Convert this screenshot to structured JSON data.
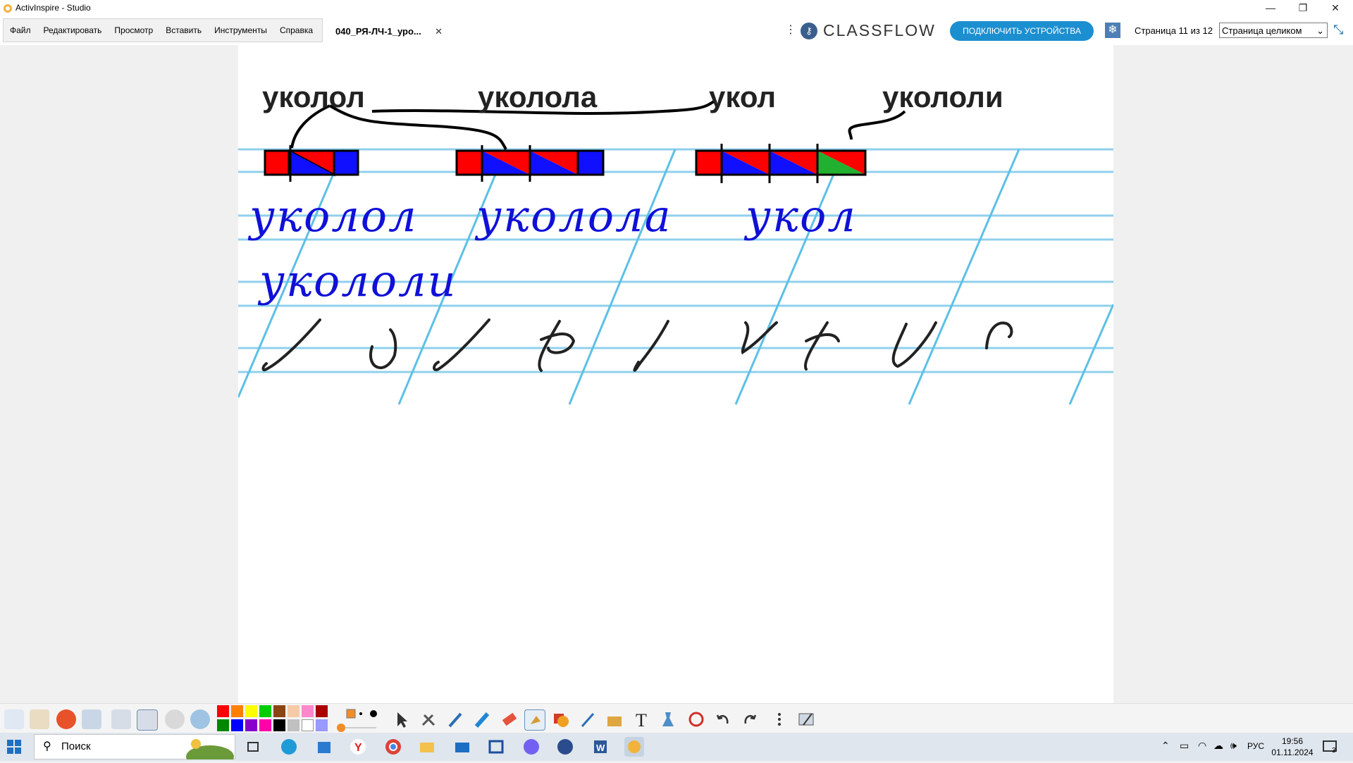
{
  "window": {
    "title": "ActivInspire - Studio",
    "minimize": "—",
    "restore": "❐",
    "close": "✕"
  },
  "menu": {
    "items": [
      "Файл",
      "Редактировать",
      "Просмотр",
      "Вставить",
      "Инструменты",
      "Справка"
    ]
  },
  "document_tab": {
    "label": "040_РЯ-ЛЧ-1_уро...",
    "close": "✕"
  },
  "classflow": {
    "logo": "CLASSFLOW",
    "connect_label": "ПОДКЛЮЧИТЬ УСТРОЙСТВА"
  },
  "page": {
    "info": "Страница 11 из 12",
    "zoom": "Страница целиком"
  },
  "canvas": {
    "printed_words": [
      "уколол",
      "уколола",
      "укол",
      "укололи"
    ],
    "script_words_row1": [
      "уколол",
      "уколола",
      "укол"
    ],
    "script_words_row2": [
      "укололи"
    ],
    "scheme_colors": {
      "consonant": "#ff0000",
      "vowel": "#1010ff",
      "accent_green": "#22b030",
      "outline": "#000000"
    }
  },
  "toolbar": {
    "colors": [
      "#ff0000",
      "#ff8000",
      "#ffff00",
      "#00cc00",
      "#8b4513",
      "#f5cba7",
      "#ff88cc",
      "#aa0000",
      "#008800",
      "#0000ff",
      "#8800cc",
      "#ff00aa",
      "#000000",
      "#c0c0c0",
      "#ffffff",
      "#9999ff"
    ]
  },
  "taskbar": {
    "search_placeholder": "Поиск",
    "language": "РУС",
    "time": "19:56",
    "date": "01.11.2024",
    "notifications": "3"
  }
}
